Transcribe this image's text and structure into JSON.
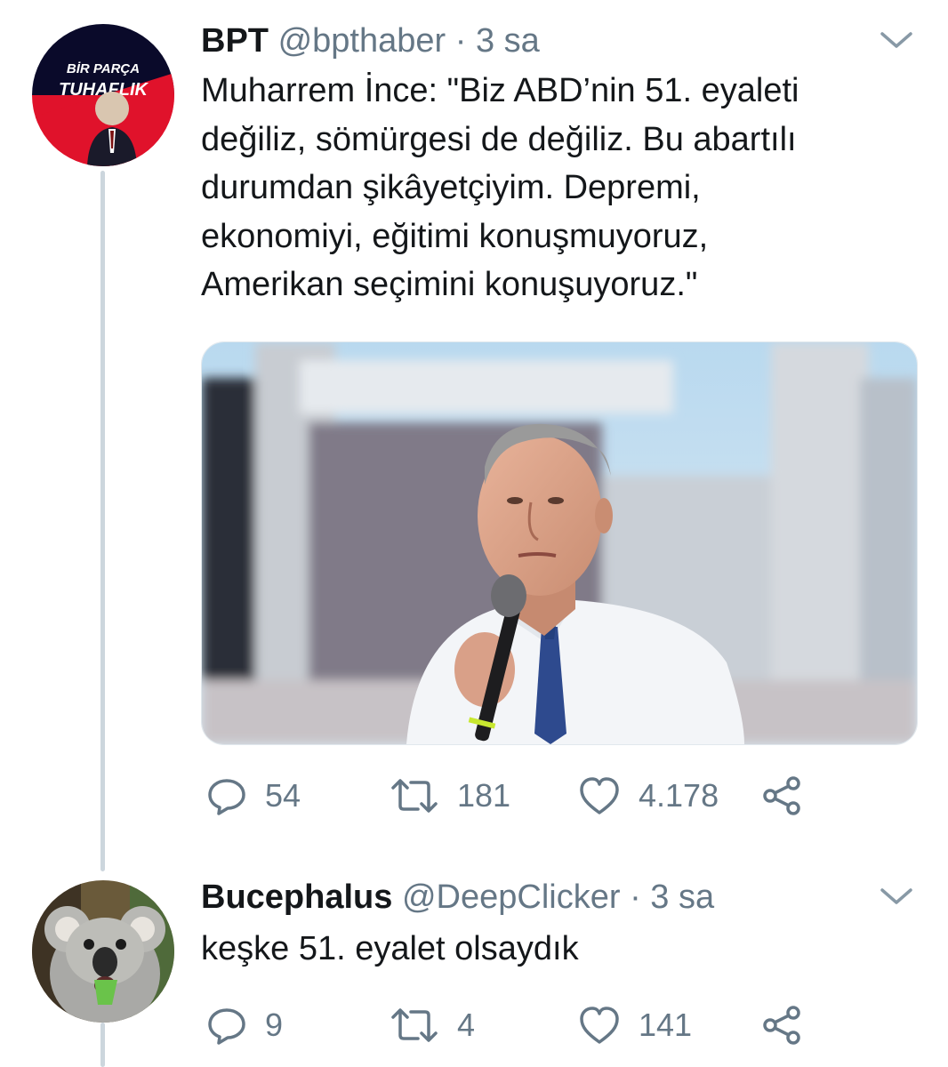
{
  "tweets": [
    {
      "avatar_text": [
        "BİR PARÇA",
        "TUHAFLIK"
      ],
      "name": "BPT",
      "handle": "@bpthaber",
      "separator": "·",
      "time": "3 sa",
      "text_lines": [
        "Muharrem İnce: \"Biz ABD’nin 51. eyaleti",
        "değiliz, sömürgesi de değiliz. Bu abartılı",
        "durumdan şikâyetçiyim. Depremi,",
        "ekonomiyi, eğitimi konuşmuyoruz,",
        "Amerikan seçimini konuşuyoruz.\""
      ],
      "media": "photo of a man in a white shirt and blue tie speaking into a microphone",
      "actions": {
        "replies": "54",
        "retweets": "181",
        "likes": "4.178"
      }
    },
    {
      "name": "Bucephalus",
      "handle": "@DeepClicker",
      "separator": "·",
      "time": "3 sa",
      "text_lines": [
        "keşke 51. eyalet olsaydık"
      ],
      "actions": {
        "replies": "9",
        "retweets": "4",
        "likes": "141"
      }
    }
  ],
  "icons": {
    "reply": "reply-icon",
    "retweet": "retweet-icon",
    "like": "heart-icon",
    "share": "share-icon",
    "caret": "chevron-down-icon"
  },
  "colors": {
    "icon_gray": "#657786",
    "thread_line": "#ccd6dd",
    "text": "#14171a"
  }
}
